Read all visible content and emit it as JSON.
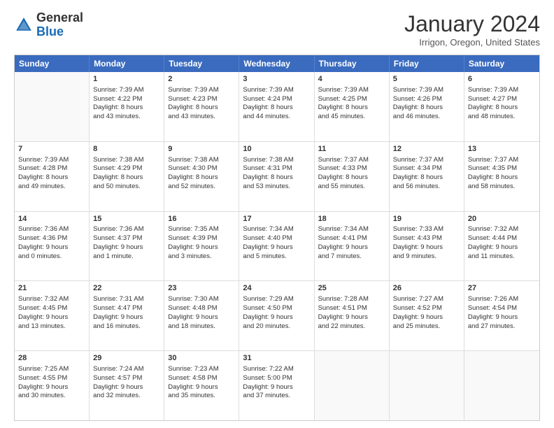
{
  "header": {
    "logo_general": "General",
    "logo_blue": "Blue",
    "month_title": "January 2024",
    "location": "Irrigon, Oregon, United States"
  },
  "calendar": {
    "days_of_week": [
      "Sunday",
      "Monday",
      "Tuesday",
      "Wednesday",
      "Thursday",
      "Friday",
      "Saturday"
    ],
    "rows": [
      [
        {
          "day": "",
          "empty": true,
          "lines": []
        },
        {
          "day": "1",
          "empty": false,
          "lines": [
            "Sunrise: 7:39 AM",
            "Sunset: 4:22 PM",
            "Daylight: 8 hours",
            "and 43 minutes."
          ]
        },
        {
          "day": "2",
          "empty": false,
          "lines": [
            "Sunrise: 7:39 AM",
            "Sunset: 4:23 PM",
            "Daylight: 8 hours",
            "and 43 minutes."
          ]
        },
        {
          "day": "3",
          "empty": false,
          "lines": [
            "Sunrise: 7:39 AM",
            "Sunset: 4:24 PM",
            "Daylight: 8 hours",
            "and 44 minutes."
          ]
        },
        {
          "day": "4",
          "empty": false,
          "lines": [
            "Sunrise: 7:39 AM",
            "Sunset: 4:25 PM",
            "Daylight: 8 hours",
            "and 45 minutes."
          ]
        },
        {
          "day": "5",
          "empty": false,
          "lines": [
            "Sunrise: 7:39 AM",
            "Sunset: 4:26 PM",
            "Daylight: 8 hours",
            "and 46 minutes."
          ]
        },
        {
          "day": "6",
          "empty": false,
          "lines": [
            "Sunrise: 7:39 AM",
            "Sunset: 4:27 PM",
            "Daylight: 8 hours",
            "and 48 minutes."
          ]
        }
      ],
      [
        {
          "day": "7",
          "empty": false,
          "lines": [
            "Sunrise: 7:39 AM",
            "Sunset: 4:28 PM",
            "Daylight: 8 hours",
            "and 49 minutes."
          ]
        },
        {
          "day": "8",
          "empty": false,
          "lines": [
            "Sunrise: 7:38 AM",
            "Sunset: 4:29 PM",
            "Daylight: 8 hours",
            "and 50 minutes."
          ]
        },
        {
          "day": "9",
          "empty": false,
          "lines": [
            "Sunrise: 7:38 AM",
            "Sunset: 4:30 PM",
            "Daylight: 8 hours",
            "and 52 minutes."
          ]
        },
        {
          "day": "10",
          "empty": false,
          "lines": [
            "Sunrise: 7:38 AM",
            "Sunset: 4:31 PM",
            "Daylight: 8 hours",
            "and 53 minutes."
          ]
        },
        {
          "day": "11",
          "empty": false,
          "lines": [
            "Sunrise: 7:37 AM",
            "Sunset: 4:33 PM",
            "Daylight: 8 hours",
            "and 55 minutes."
          ]
        },
        {
          "day": "12",
          "empty": false,
          "lines": [
            "Sunrise: 7:37 AM",
            "Sunset: 4:34 PM",
            "Daylight: 8 hours",
            "and 56 minutes."
          ]
        },
        {
          "day": "13",
          "empty": false,
          "lines": [
            "Sunrise: 7:37 AM",
            "Sunset: 4:35 PM",
            "Daylight: 8 hours",
            "and 58 minutes."
          ]
        }
      ],
      [
        {
          "day": "14",
          "empty": false,
          "lines": [
            "Sunrise: 7:36 AM",
            "Sunset: 4:36 PM",
            "Daylight: 9 hours",
            "and 0 minutes."
          ]
        },
        {
          "day": "15",
          "empty": false,
          "lines": [
            "Sunrise: 7:36 AM",
            "Sunset: 4:37 PM",
            "Daylight: 9 hours",
            "and 1 minute."
          ]
        },
        {
          "day": "16",
          "empty": false,
          "lines": [
            "Sunrise: 7:35 AM",
            "Sunset: 4:39 PM",
            "Daylight: 9 hours",
            "and 3 minutes."
          ]
        },
        {
          "day": "17",
          "empty": false,
          "lines": [
            "Sunrise: 7:34 AM",
            "Sunset: 4:40 PM",
            "Daylight: 9 hours",
            "and 5 minutes."
          ]
        },
        {
          "day": "18",
          "empty": false,
          "lines": [
            "Sunrise: 7:34 AM",
            "Sunset: 4:41 PM",
            "Daylight: 9 hours",
            "and 7 minutes."
          ]
        },
        {
          "day": "19",
          "empty": false,
          "lines": [
            "Sunrise: 7:33 AM",
            "Sunset: 4:43 PM",
            "Daylight: 9 hours",
            "and 9 minutes."
          ]
        },
        {
          "day": "20",
          "empty": false,
          "lines": [
            "Sunrise: 7:32 AM",
            "Sunset: 4:44 PM",
            "Daylight: 9 hours",
            "and 11 minutes."
          ]
        }
      ],
      [
        {
          "day": "21",
          "empty": false,
          "lines": [
            "Sunrise: 7:32 AM",
            "Sunset: 4:45 PM",
            "Daylight: 9 hours",
            "and 13 minutes."
          ]
        },
        {
          "day": "22",
          "empty": false,
          "lines": [
            "Sunrise: 7:31 AM",
            "Sunset: 4:47 PM",
            "Daylight: 9 hours",
            "and 16 minutes."
          ]
        },
        {
          "day": "23",
          "empty": false,
          "lines": [
            "Sunrise: 7:30 AM",
            "Sunset: 4:48 PM",
            "Daylight: 9 hours",
            "and 18 minutes."
          ]
        },
        {
          "day": "24",
          "empty": false,
          "lines": [
            "Sunrise: 7:29 AM",
            "Sunset: 4:50 PM",
            "Daylight: 9 hours",
            "and 20 minutes."
          ]
        },
        {
          "day": "25",
          "empty": false,
          "lines": [
            "Sunrise: 7:28 AM",
            "Sunset: 4:51 PM",
            "Daylight: 9 hours",
            "and 22 minutes."
          ]
        },
        {
          "day": "26",
          "empty": false,
          "lines": [
            "Sunrise: 7:27 AM",
            "Sunset: 4:52 PM",
            "Daylight: 9 hours",
            "and 25 minutes."
          ]
        },
        {
          "day": "27",
          "empty": false,
          "lines": [
            "Sunrise: 7:26 AM",
            "Sunset: 4:54 PM",
            "Daylight: 9 hours",
            "and 27 minutes."
          ]
        }
      ],
      [
        {
          "day": "28",
          "empty": false,
          "lines": [
            "Sunrise: 7:25 AM",
            "Sunset: 4:55 PM",
            "Daylight: 9 hours",
            "and 30 minutes."
          ]
        },
        {
          "day": "29",
          "empty": false,
          "lines": [
            "Sunrise: 7:24 AM",
            "Sunset: 4:57 PM",
            "Daylight: 9 hours",
            "and 32 minutes."
          ]
        },
        {
          "day": "30",
          "empty": false,
          "lines": [
            "Sunrise: 7:23 AM",
            "Sunset: 4:58 PM",
            "Daylight: 9 hours",
            "and 35 minutes."
          ]
        },
        {
          "day": "31",
          "empty": false,
          "lines": [
            "Sunrise: 7:22 AM",
            "Sunset: 5:00 PM",
            "Daylight: 9 hours",
            "and 37 minutes."
          ]
        },
        {
          "day": "",
          "empty": true,
          "lines": []
        },
        {
          "day": "",
          "empty": true,
          "lines": []
        },
        {
          "day": "",
          "empty": true,
          "lines": []
        }
      ]
    ]
  }
}
